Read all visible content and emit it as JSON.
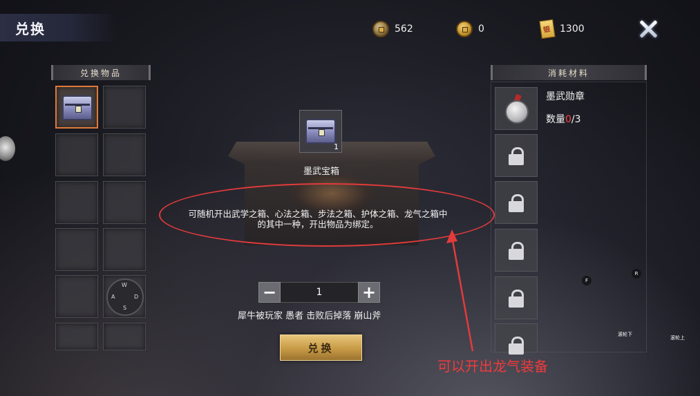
{
  "header": {
    "title": "兑换"
  },
  "currencies": [
    {
      "icon": "copper-coin-icon",
      "value": "562"
    },
    {
      "icon": "gold-coin-icon",
      "value": "0"
    },
    {
      "icon": "silver-ticket-icon",
      "value": "1300"
    }
  ],
  "left_panel": {
    "title": "兑换物品"
  },
  "right_panel": {
    "title": "消耗材料",
    "material": {
      "name": "墨武勋章",
      "qty_label": "数量",
      "qty_have": "0",
      "qty_need": "/3"
    }
  },
  "item": {
    "name": "墨武宝箱",
    "count": "1",
    "description_line1": "可随机开出武学之箱、心法之箱、步法之箱、护体之箱、龙气之箱中",
    "description_line2": "的其中一种，开出物品为绑定。"
  },
  "quantity": {
    "minus": "−",
    "value": "1",
    "plus": "+"
  },
  "drop_info": "犀牛被玩家 愚者 击败后掉落 崩山斧",
  "exchange_button": "兑换",
  "annotation": "可以开出龙气装备",
  "joystick": {
    "up": "W",
    "left": "A",
    "down": "S",
    "right": "D"
  },
  "key_hints": {
    "f": "F",
    "r": "R",
    "scroll_down": "滚轮下",
    "scroll_up": "滚轮上"
  },
  "colors": {
    "accent_gold": "#c79a45",
    "selected_border": "#e07a3a",
    "annotation_red": "#e23b3b",
    "qty_insufficient": "#ff4545"
  }
}
